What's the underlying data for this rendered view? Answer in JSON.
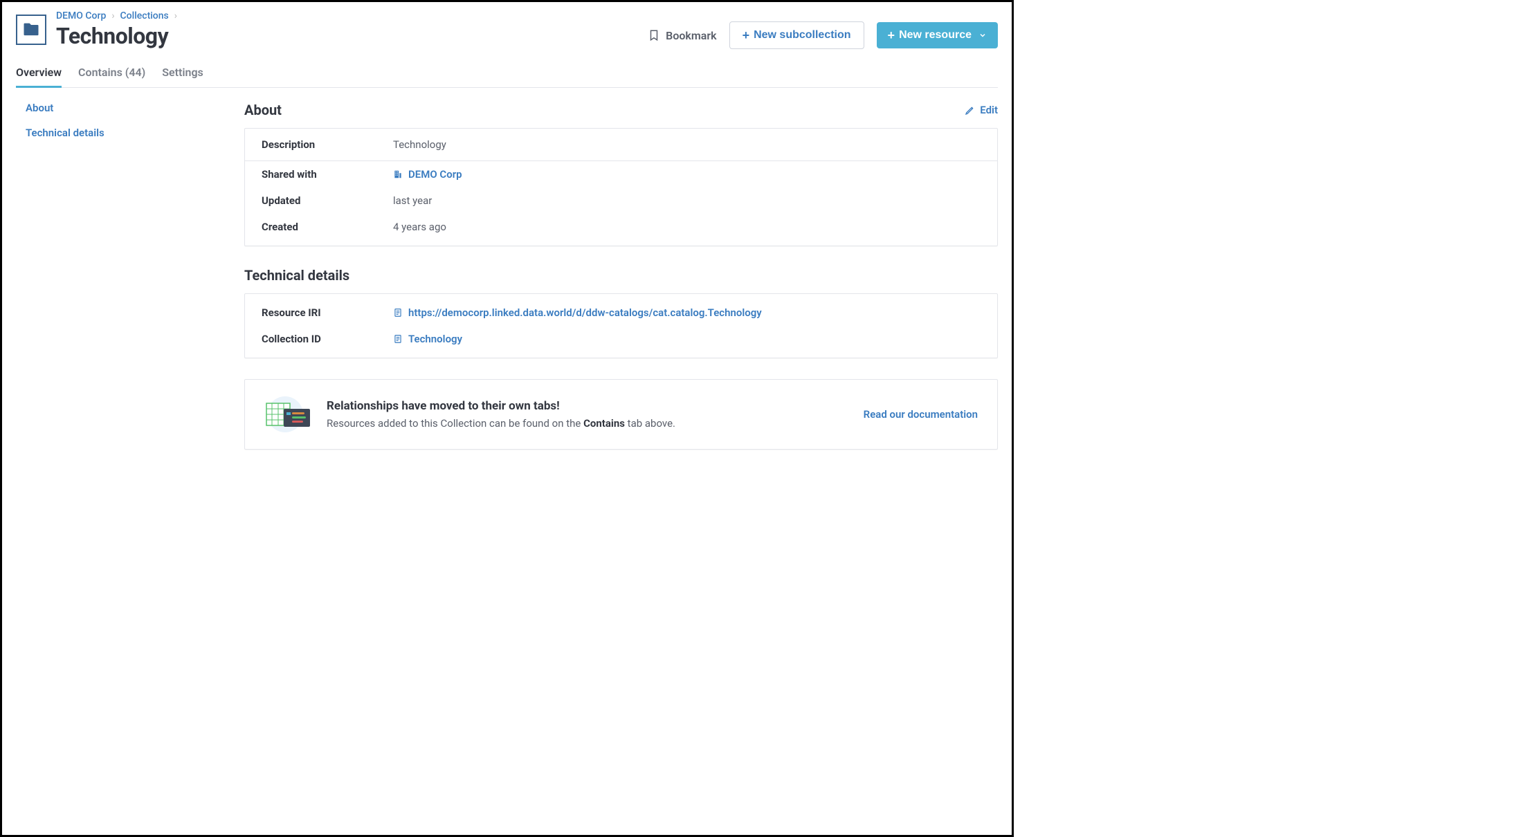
{
  "breadcrumbs": {
    "org": "DEMO Corp",
    "section": "Collections"
  },
  "page_title": "Technology",
  "actions": {
    "bookmark": "Bookmark",
    "new_subcollection": "New subcollection",
    "new_resource": "New resource"
  },
  "tabs": {
    "overview": "Overview",
    "contains": "Contains (44)",
    "settings": "Settings"
  },
  "sidebar": {
    "about": "About",
    "technical": "Technical details"
  },
  "about": {
    "heading": "About",
    "edit": "Edit",
    "description_label": "Description",
    "description_value": "Technology",
    "shared_label": "Shared with",
    "shared_value": "DEMO Corp",
    "updated_label": "Updated",
    "updated_value": "last year",
    "created_label": "Created",
    "created_value": "4 years ago"
  },
  "technical": {
    "heading": "Technical details",
    "iri_label": "Resource IRI",
    "iri_value": "https://democorp.linked.data.world/d/ddw-catalogs/cat.catalog.Technology",
    "colid_label": "Collection ID",
    "colid_value": "Technology"
  },
  "banner": {
    "title": "Relationships have moved to their own tabs!",
    "sub_prefix": "Resources added to this Collection can be found on the ",
    "sub_bold": "Contains",
    "sub_suffix": " tab above.",
    "link": "Read our documentation"
  }
}
